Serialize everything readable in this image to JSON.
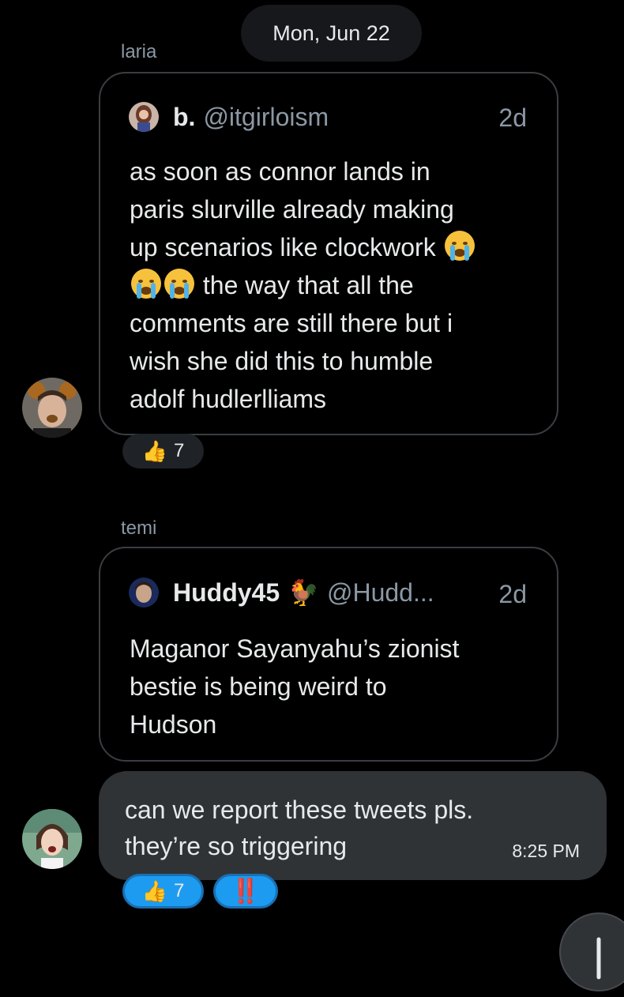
{
  "date_divider": "Mon, Jun 22",
  "messages": [
    {
      "sender": "laria",
      "quote": {
        "name": "b.",
        "handle": "@itgirloism",
        "time": "2d",
        "lines": [
          "as soon as connor lands in",
          "paris slurville already making",
          "up scenarios like clockwork",
          "the way that all the",
          "comments are still there but i",
          "wish she did this to humble",
          "adolf hudlerlliams"
        ]
      },
      "reaction": {
        "emoji": "👍",
        "count": "7"
      }
    },
    {
      "sender": "temi",
      "quote": {
        "name": "Huddy45",
        "name_emoji": "🐓",
        "handle": "@Hudd...",
        "time": "2d",
        "lines": [
          "Maganor Sayanyahu’s zionist",
          "bestie is being weird to",
          "Hudson"
        ]
      },
      "text_lines": [
        "can we report these tweets pls.",
        "they’re so triggering"
      ],
      "time": "8:25 PM",
      "reactions": [
        {
          "emoji": "👍",
          "count": "7"
        },
        {
          "emoji": "‼️"
        }
      ]
    }
  ],
  "colors": {
    "background": "#000000",
    "bubble": "#2f3336",
    "card_border": "#3a3d42",
    "muted_text": "#8b98a5",
    "accent": "#1d9bf0",
    "alert": "#f4212e"
  },
  "icons": [
    "crying-face-emoji",
    "thumbs-up-emoji",
    "rooster-emoji",
    "double-exclamation-emoji"
  ]
}
